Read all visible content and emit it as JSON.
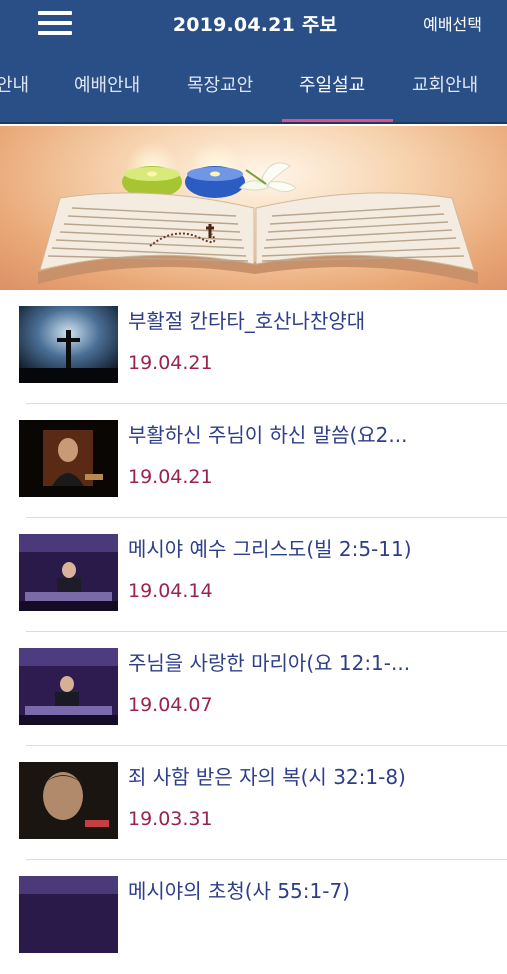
{
  "header": {
    "title": "2019.04.21 주보",
    "service_select": "예배선택"
  },
  "tabs": [
    {
      "label": "안내"
    },
    {
      "label": "예배안내"
    },
    {
      "label": "목장교안"
    },
    {
      "label": "주일설교"
    },
    {
      "label": "교회안내"
    }
  ],
  "active_tab": "주일설교",
  "colors": {
    "header_bg": "#2a4f86",
    "tab_indicator": "#e0508f",
    "item_title": "#2e3e8a",
    "item_date": "#9a2152"
  },
  "sermons": [
    {
      "title": "부활절 칸타타_호산나찬양대",
      "date": "19.04.21"
    },
    {
      "title": "부활하신 주님이 하신 말씀(요2...",
      "date": "19.04.21"
    },
    {
      "title": "메시야 예수 그리스도(빌 2:5-11)",
      "date": "19.04.14"
    },
    {
      "title": "주님을 사랑한 마리아(요 12:1-...",
      "date": "19.04.07"
    },
    {
      "title": "죄 사함 받은 자의 복(시 32:1-8)",
      "date": "19.03.31"
    },
    {
      "title": "메시야의 초청(사 55:1-7)",
      "date": ""
    }
  ]
}
